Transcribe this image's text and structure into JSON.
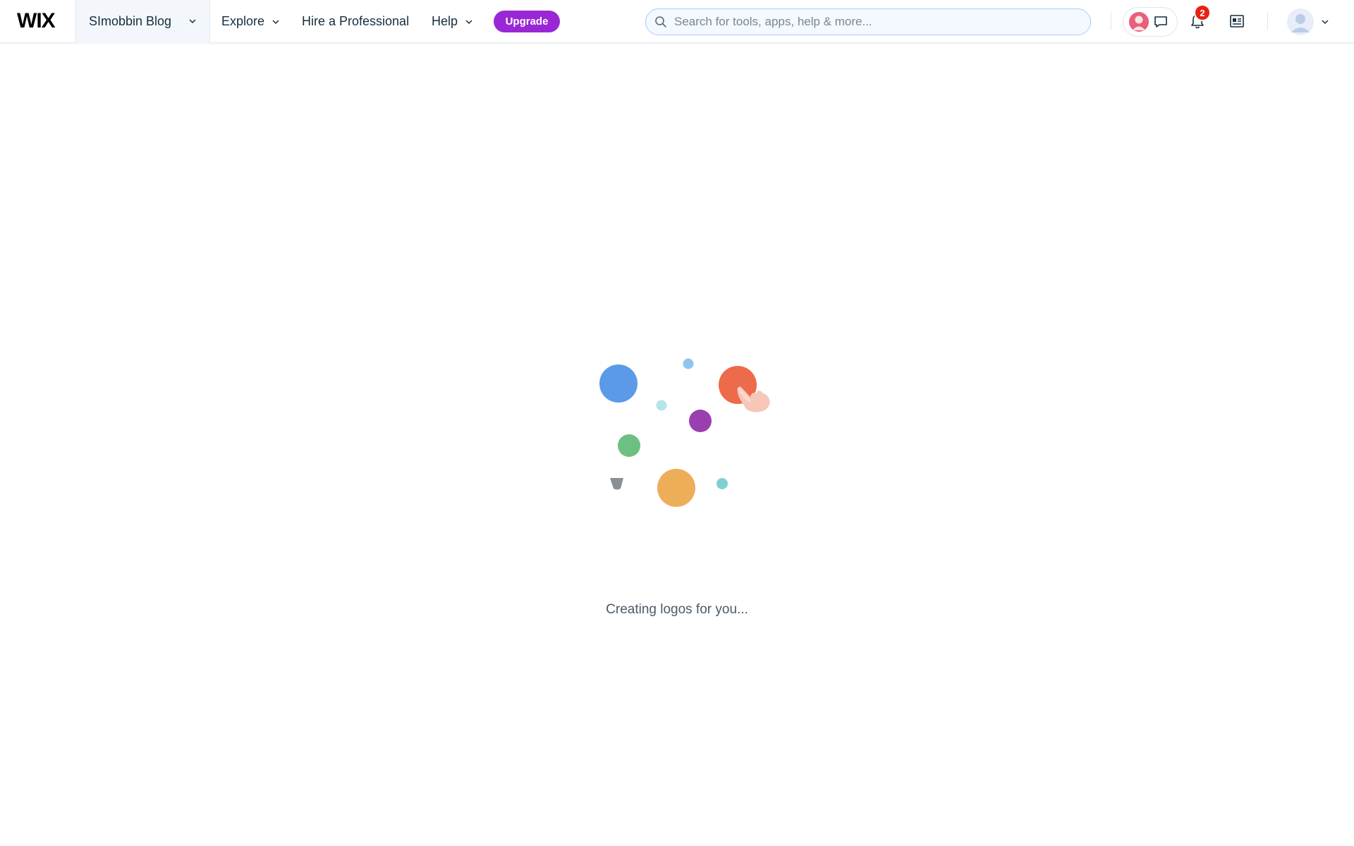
{
  "header": {
    "logo": "WIX",
    "site_name": "SImobbin Blog",
    "nav": {
      "explore": "Explore",
      "hire": "Hire a Professional",
      "help": "Help"
    },
    "upgrade_label": "Upgrade",
    "search": {
      "placeholder": "Search for tools, apps, help & more..."
    },
    "notifications_count": "2"
  },
  "main": {
    "loading_text": "Creating logos for you..."
  },
  "colors": {
    "accent": "#9a27d5",
    "search_border": "#a8caff",
    "badge": "#e62214",
    "dot_blue": "#5b9ae6",
    "dot_red": "#ed6a4a",
    "dot_purple": "#9a3fb0",
    "dot_green": "#6cc081",
    "dot_orange": "#edae5a",
    "dot_teal": "#7fd0d3",
    "dot_lightblue": "#8fc7ec"
  },
  "icons": [
    "search-icon",
    "chat-icon",
    "bell-icon",
    "news-icon",
    "user-avatar-icon",
    "chevron-down-icon",
    "hand-pointer-icon"
  ]
}
